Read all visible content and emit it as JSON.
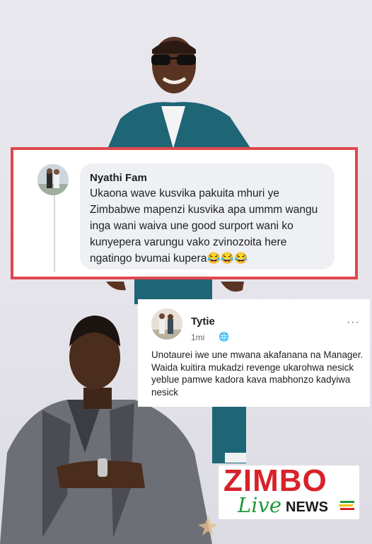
{
  "comment1": {
    "author": "Nyathi Fam",
    "text": "Ukaona wave kusvika pakuita mhuri ye Zimbabwe mapenzi kusvika apa ummm wangu inga wani waiva une good surport wani ko kunyepera varungu vako zvinozoita here ngatingo bvumai kupera😂😂😂"
  },
  "comment2": {
    "author": "Tytie",
    "time": "1mi",
    "globe": "🌐",
    "more": "···",
    "text": "Unotaurei iwe une mwana akafanana na Manager. Waida kuitira mukadzi revenge ukarohwa nesick yeblue pamwe kadora kava mabhonzo kadyiwa nesick"
  },
  "logo": {
    "brand": "ZIMBO",
    "live": "Live",
    "news": "NEWS"
  },
  "colors": {
    "frame_red": "#e0474c",
    "brand_red": "#d8222a",
    "brand_green": "#1f9a3a",
    "suit_teal": "#1e6576",
    "suit_grey": "#6d6f76"
  }
}
